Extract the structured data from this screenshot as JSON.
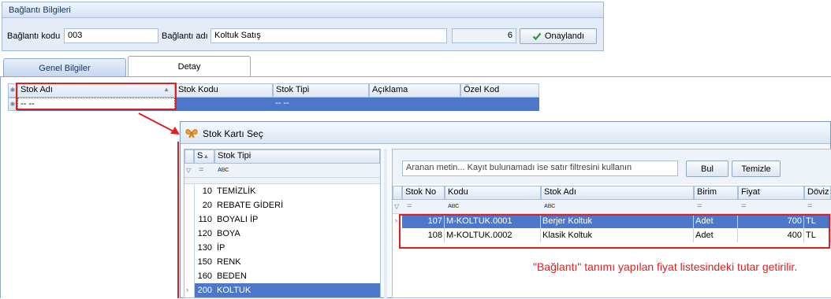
{
  "group": {
    "title": "Bağlantı Bilgileri",
    "code_label": "Bağlantı kodu",
    "code_value": "003",
    "name_label": "Bağlantı adı",
    "name_value": "Koltuk Satış",
    "count_value": "6",
    "approved_label": "Onaylandı"
  },
  "tabs": {
    "general": "Genel Bilgiler",
    "detail": "Detay"
  },
  "detail_grid": {
    "columns": [
      "Stok Adı",
      "Stok Kodu",
      "Stok Tipi",
      "Açıklama",
      "Özel Kod"
    ],
    "new_row": {
      "stok_adi": "-- --",
      "stok_tipi": "-- --"
    }
  },
  "dialog": {
    "title": "Stok Kartı Seç",
    "type_grid": {
      "col_s": "S",
      "col_type": "Stok Tipi",
      "filter_eq": "=",
      "rows": [
        {
          "code": "10",
          "name": "TEMİZLİK"
        },
        {
          "code": "20",
          "name": "REBATE GİDERİ"
        },
        {
          "code": "110",
          "name": "BOYALI İP"
        },
        {
          "code": "120",
          "name": "BOYA"
        },
        {
          "code": "130",
          "name": "İP"
        },
        {
          "code": "150",
          "name": "RENK"
        },
        {
          "code": "160",
          "name": "BEDEN"
        },
        {
          "code": "200",
          "name": "KOLTUK"
        }
      ]
    },
    "search": {
      "placeholder": "Aranan metin... Kayıt bulunamadı ise satır filtresini kullanın",
      "find_button": "Bul",
      "clear_button": "Temizle"
    },
    "stock_grid": {
      "columns": [
        "Stok No",
        "Kodu",
        "Stok Adı",
        "Birim",
        "Fiyat",
        "Döviz"
      ],
      "filter_eq": "=",
      "rows": [
        {
          "no": "107",
          "code": "M-KOLTUK.0001",
          "name": "Berjer Koltuk",
          "unit": "Adet",
          "price": "700",
          "currency": "TL"
        },
        {
          "no": "108",
          "code": "M-KOLTUK.0002",
          "name": "Klasik Koltuk",
          "unit": "Adet",
          "price": "400",
          "currency": "TL"
        }
      ]
    }
  },
  "annotation": "\"Bağlantı\" tanımı yapılan fiyat listesindeki tutar getirilir.",
  "colors": {
    "highlight": "#e0201f",
    "selection": "#4d78c9",
    "annotation": "#e0201f"
  }
}
